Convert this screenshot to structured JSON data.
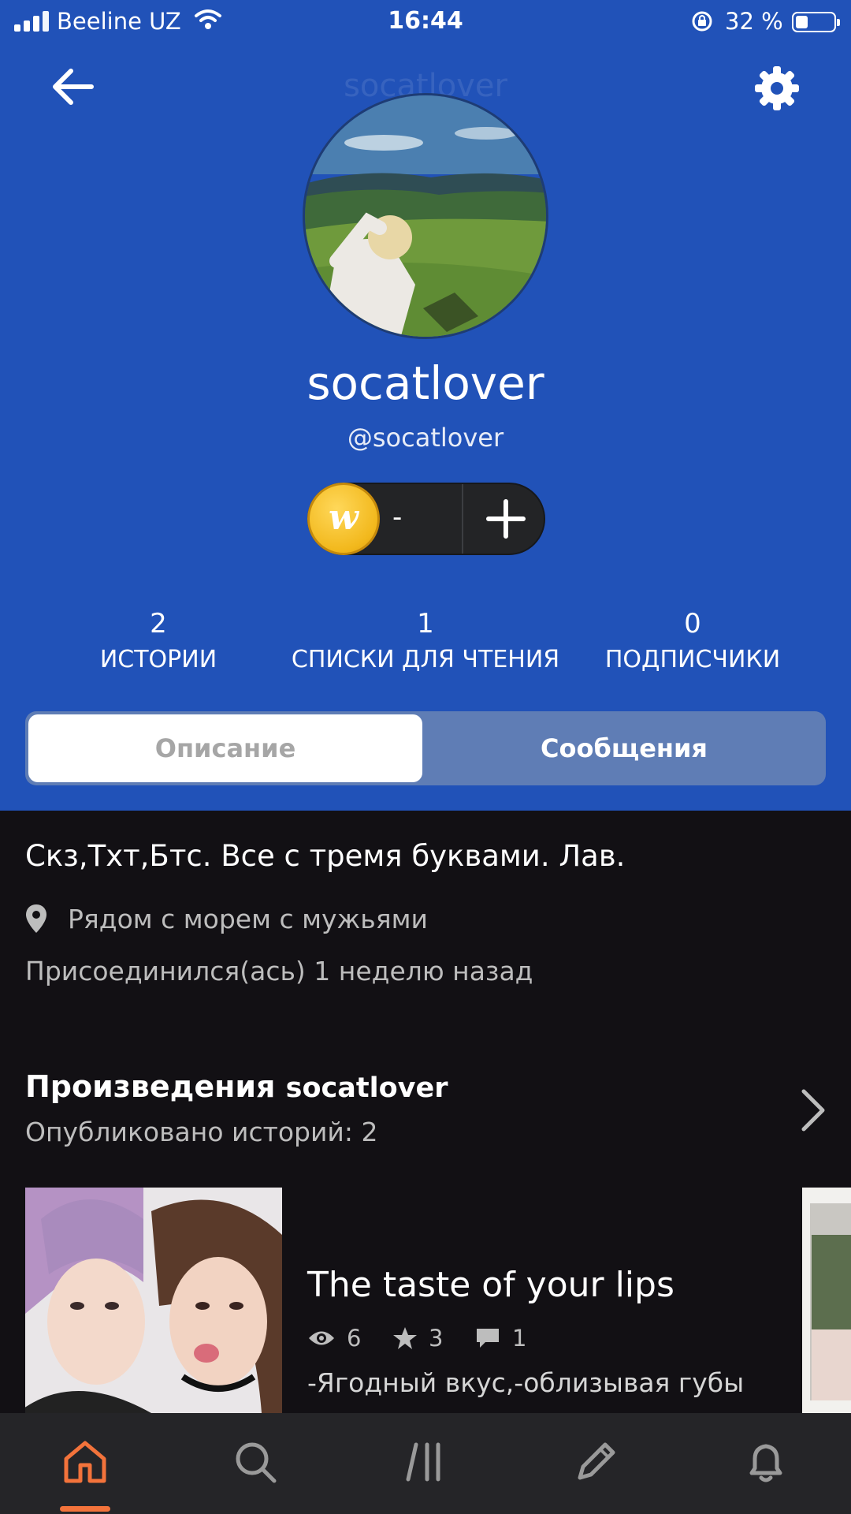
{
  "status_bar": {
    "carrier": "Beeline UZ",
    "time": "16:44",
    "battery_text": "32 %",
    "battery_level": 0.32
  },
  "header": {
    "ghost_title": "socatlover",
    "display_name": "socatlover",
    "handle": "@socatlover",
    "coins": "-",
    "background_color": "#2152b8"
  },
  "stats": [
    {
      "value": "2",
      "label": "ИСТОРИИ"
    },
    {
      "value": "1",
      "label": "СПИСКИ ДЛЯ ЧТЕНИЯ"
    },
    {
      "value": "0",
      "label": "ПОДПИСЧИКИ"
    }
  ],
  "segment": {
    "tab1": "Описание",
    "tab2": "Сообщения",
    "active": "Описание"
  },
  "about": {
    "bio": "Скз,Тхт,Бтс. Все с тремя буквами. Лав.",
    "location": "Рядом с морем с мужьями",
    "joined": "Присоединился(ась) 1 неделю назад"
  },
  "works": {
    "title": "Произведения",
    "user": "socatlover",
    "subtitle": "Опубликовано историй: 2",
    "stories": [
      {
        "title": "The taste of your lips",
        "views": "6",
        "votes": "3",
        "comments": "1",
        "description": "-Ягодный вкус,-облизывая губы"
      }
    ]
  },
  "tabbar": {
    "items": [
      "home-icon",
      "search-icon",
      "library-icon",
      "write-icon",
      "notifications-icon"
    ],
    "active": "home-icon",
    "accent_color": "#f3733b"
  }
}
